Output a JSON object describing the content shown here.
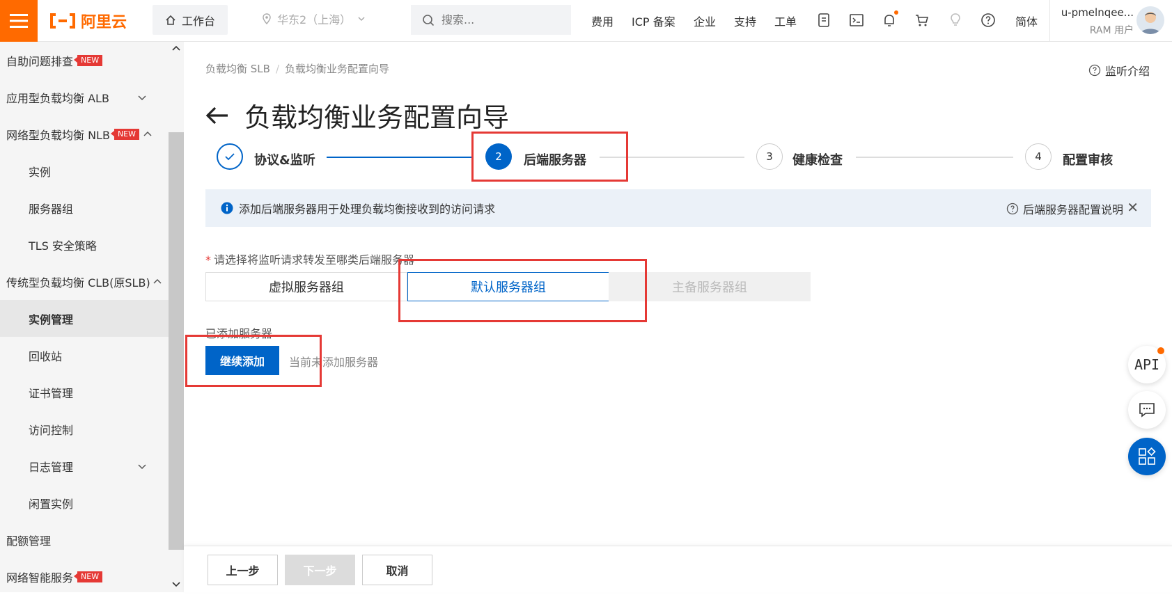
{
  "topbar": {
    "logo_text": "阿里云",
    "workbench": "工作台",
    "region": "华东2（上海）",
    "search_placeholder": "搜索...",
    "links": [
      "费用",
      "ICP 备案",
      "企业",
      "支持",
      "工单"
    ],
    "lang": "简体",
    "user_name": "u-pmelnqee...",
    "user_role": "RAM 用户",
    "accent_color": "#ff6a00"
  },
  "sidebar": {
    "items": [
      {
        "label": "自助问题排查",
        "tag": "NEW"
      },
      {
        "label": "应用型负载均衡 ALB"
      },
      {
        "label": "网络型负载均衡 NLB",
        "tag": "NEW"
      },
      {
        "label": "实例"
      },
      {
        "label": "服务器组"
      },
      {
        "label": "TLS 安全策略"
      },
      {
        "label": "传统型负载均衡 CLB(原SLB)"
      },
      {
        "label": "实例管理"
      },
      {
        "label": "回收站"
      },
      {
        "label": "证书管理"
      },
      {
        "label": "访问控制"
      },
      {
        "label": "日志管理"
      },
      {
        "label": "闲置实例"
      },
      {
        "label": "配额管理"
      },
      {
        "label": "网络智能服务",
        "tag": "NEW"
      }
    ]
  },
  "breadcrumb": [
    "负载均衡 SLB",
    "负载均衡业务配置向导"
  ],
  "help_link": "监听介绍",
  "page_title": "负载均衡业务配置向导",
  "steps": [
    {
      "num": "1",
      "label": "协议&监听",
      "state": "done"
    },
    {
      "num": "2",
      "label": "后端服务器",
      "state": "active"
    },
    {
      "num": "3",
      "label": "健康检查",
      "state": "pending"
    },
    {
      "num": "4",
      "label": "配置审核",
      "state": "pending"
    }
  ],
  "info": {
    "text": "添加后端服务器用于处理负载均衡接收到的访问请求",
    "link": "后端服务器配置说明"
  },
  "form": {
    "required_mark": "*",
    "label": "请选择将监听请求转发至哪类后端服务器",
    "options": [
      "虚拟服务器组",
      "默认服务器组",
      "主备服务器组"
    ],
    "selected": "默认服务器组",
    "added_label": "已添加服务器",
    "add_button": "继续添加",
    "empty_text": "当前未添加服务器"
  },
  "footer": {
    "prev": "上一步",
    "next": "下一步",
    "cancel": "取消"
  },
  "float": {
    "api": "API"
  },
  "colors": {
    "primary": "#0064c8",
    "highlight": "#e53935"
  }
}
